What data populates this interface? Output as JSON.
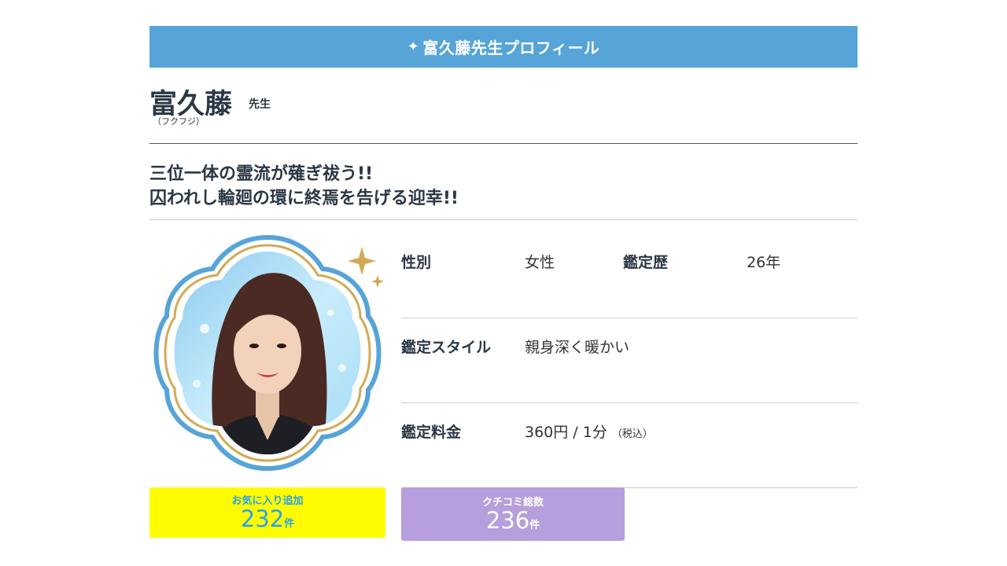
{
  "header": {
    "title": "富久藤先生プロフィール",
    "sparkle_icon": "sparkle-icon",
    "bg_color": "#56a4d8"
  },
  "profile": {
    "name": "富久藤",
    "suffix": "先生",
    "kana": "（フクフジ）",
    "catchphrase_1": "三位一体の霊流が薙ぎ祓う!!",
    "catchphrase_2": "囚われし輪廻の環に終焉を告げる迎幸!!"
  },
  "info": {
    "gender_label": "性別",
    "gender_value": "女性",
    "career_label": "鑑定歴",
    "career_value": "26年",
    "style_label": "鑑定スタイル",
    "style_value": "親身深く暖かい",
    "fee_label": "鑑定料金",
    "fee_value": "360円 / 1分",
    "fee_note": "（税込）"
  },
  "stats": {
    "favorites_label": "お気に入り追加",
    "favorites_count": "232",
    "favorites_unit": "件",
    "reviews_label": "クチコミ総数",
    "reviews_count": "236",
    "reviews_unit": "件"
  },
  "colors": {
    "favorites_bg": "#fffb00",
    "reviews_bg": "#b69fdc",
    "frame_blue": "#56a4d8",
    "frame_gold": "#d2aa55"
  }
}
